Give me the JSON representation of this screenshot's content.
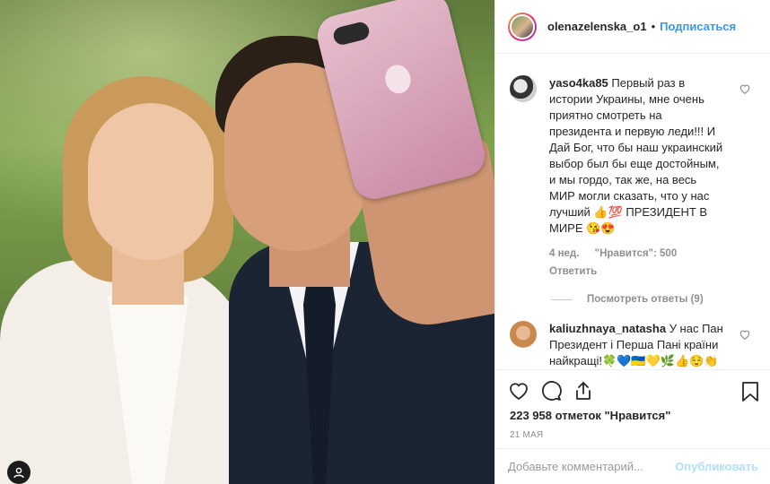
{
  "post": {
    "username": "olenazelenska_o1",
    "separator": "•",
    "follow_label": "Подписаться"
  },
  "comments": [
    {
      "username": "yaso4ka85",
      "text": "Первый раз в истории Украины, мне очень приятно смотреть на президента и первую леди!!! И Дай Бог, что бы наш украинский выбор был бы еще достойным, и мы гордо, так же, на весь МИР могли сказать, что у нас лучший 👍💯 ПРЕЗИДЕНТ В МИРЕ 😘😍",
      "age": "4 нед.",
      "likes": "\"Нравится\": 500",
      "reply_label": "Ответить",
      "view_replies": "Посмотреть ответы (9)"
    },
    {
      "username": "kaliuzhnaya_natasha",
      "text": "У нас Пан Президент і Перша Пані країни найкращі!🍀💙🇺🇦💛🌿👍😌👏"
    }
  ],
  "stats": {
    "likes": "223 958 отметок \"Нравится\"",
    "date": "21 МАЯ"
  },
  "add_comment": {
    "placeholder": "Добавьте комментарий...",
    "publish_label": "Опубликовать"
  },
  "icons": {
    "heart": "heart-icon",
    "comment": "comment-icon",
    "share": "share-icon",
    "bookmark": "bookmark-icon",
    "tag": "user-tag-icon"
  },
  "colors": {
    "link_blue": "#3897f0",
    "publish_disabled": "#b2dffc",
    "muted": "#8e8e8e"
  }
}
